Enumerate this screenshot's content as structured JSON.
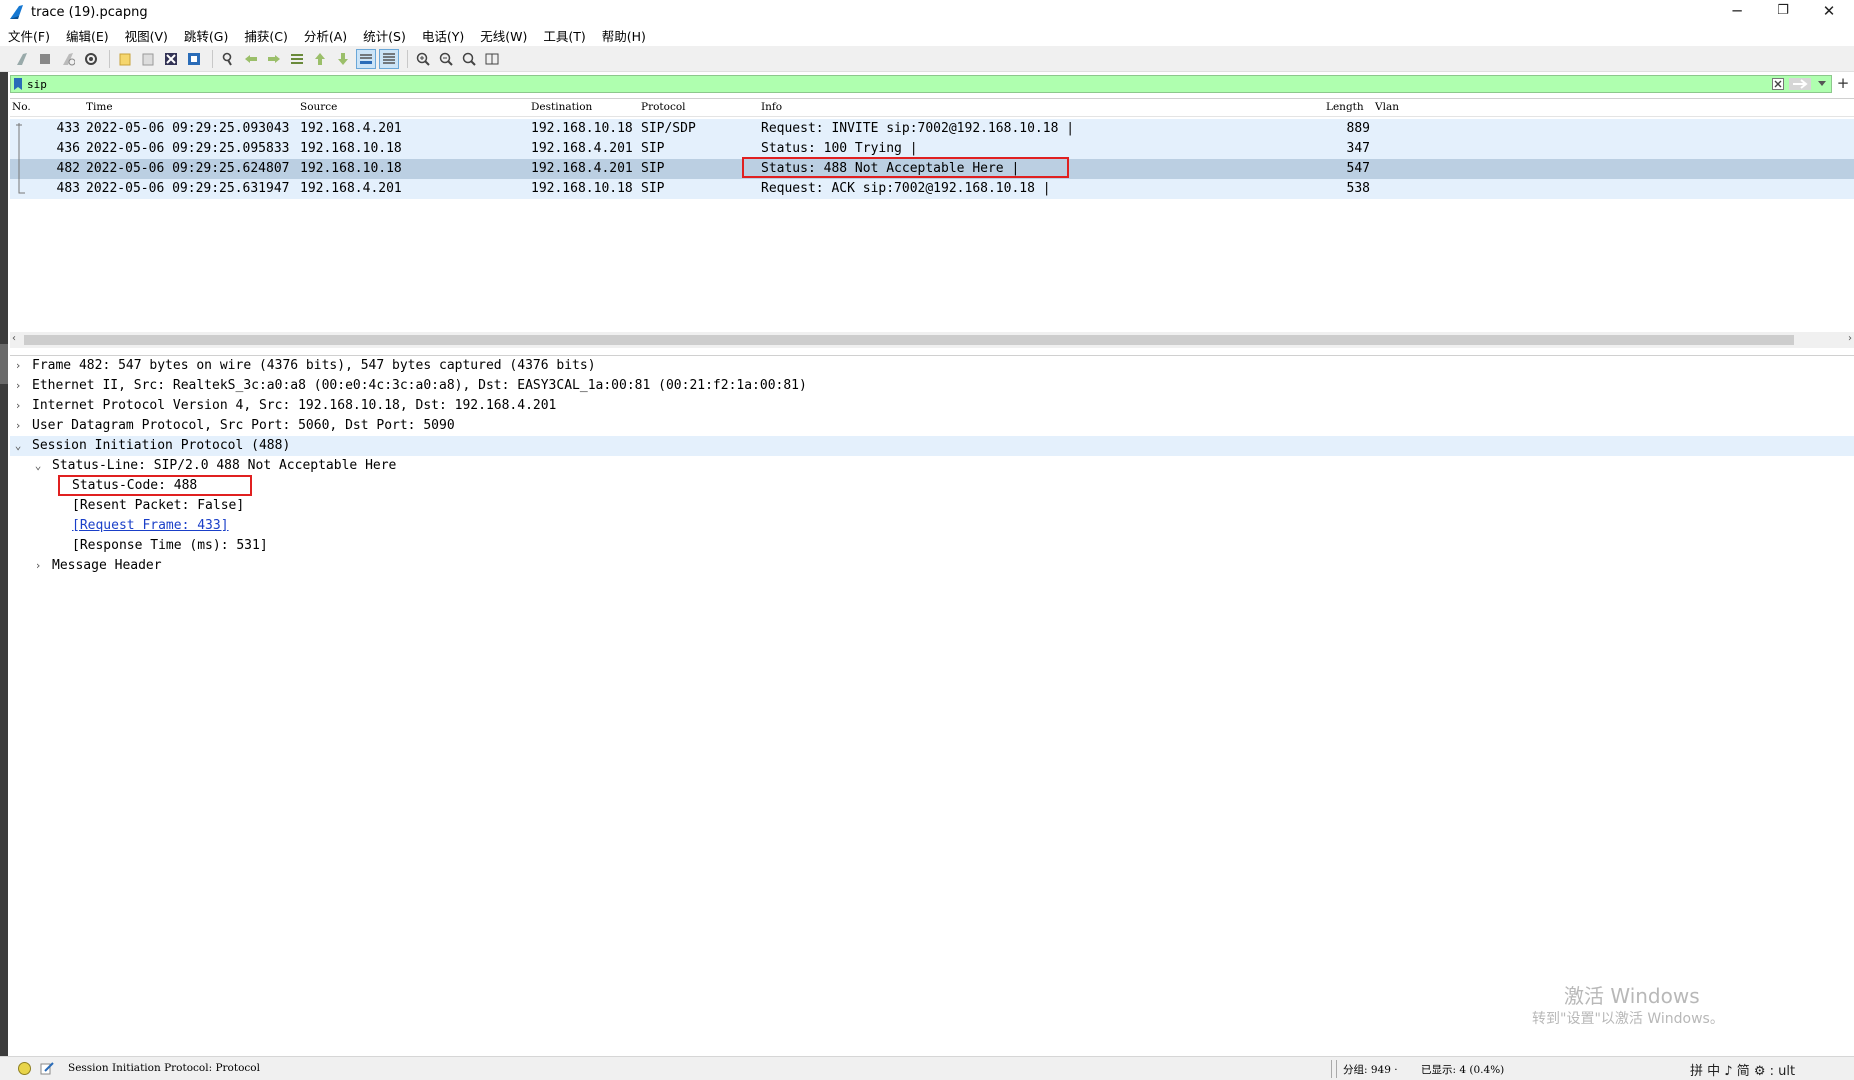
{
  "window": {
    "title": "trace (19).pcapng",
    "minimize": "─",
    "restore": "❐",
    "close": "✕"
  },
  "menu": [
    "文件(F)",
    "编辑(E)",
    "视图(V)",
    "跳转(G)",
    "捕获(C)",
    "分析(A)",
    "统计(S)",
    "电话(Y)",
    "无线(W)",
    "工具(T)",
    "帮助(H)"
  ],
  "filter": {
    "value": "sip"
  },
  "packet_list": {
    "columns": [
      "No.",
      "Time",
      "Source",
      "Destination",
      "Protocol",
      "Info",
      "Length",
      "Vlan"
    ],
    "rows": [
      {
        "no": "433",
        "time": "2022-05-06 09:29:25.093043",
        "source": "192.168.4.201",
        "destination": "192.168.10.18",
        "protocol": "SIP/SDP",
        "info": "Request: INVITE sip:7002@192.168.10.18 |",
        "length": "889"
      },
      {
        "no": "436",
        "time": "2022-05-06 09:29:25.095833",
        "source": "192.168.10.18",
        "destination": "192.168.4.201",
        "protocol": "SIP",
        "info": "Status: 100 Trying |",
        "length": "347"
      },
      {
        "no": "482",
        "time": "2022-05-06 09:29:25.624807",
        "source": "192.168.10.18",
        "destination": "192.168.4.201",
        "protocol": "SIP",
        "info": "Status: 488 Not Acceptable Here |",
        "length": "547"
      },
      {
        "no": "483",
        "time": "2022-05-06 09:29:25.631947",
        "source": "192.168.4.201",
        "destination": "192.168.10.18",
        "protocol": "SIP",
        "info": "Request: ACK sip:7002@192.168.10.18 |",
        "length": "538"
      }
    ],
    "selected_row": 2
  },
  "details": {
    "frame": "Frame 482: 547 bytes on wire (4376 bits), 547 bytes captured (4376 bits)",
    "ethernet": "Ethernet II, Src: RealtekS_3c:a0:a8 (00:e0:4c:3c:a0:a8), Dst: EASY3CAL_1a:00:81 (00:21:f2:1a:00:81)",
    "ip": "Internet Protocol Version 4, Src: 192.168.10.18, Dst: 192.168.4.201",
    "udp": "User Datagram Protocol, Src Port: 5060, Dst Port: 5090",
    "sip": "Session Initiation Protocol (488)",
    "status_line": "Status-Line: SIP/2.0 488 Not Acceptable Here",
    "status_code": "Status-Code: 488",
    "resent": "[Resent Packet: False]",
    "request_frame": "[Request Frame: 433]",
    "response_time": "[Response Time (ms): 531]",
    "message_header": "Message Header"
  },
  "watermark": {
    "title": "激活 Windows",
    "subtitle": "转到\"设置\"以激活 Windows。"
  },
  "statusbar": {
    "text": "Session Initiation Protocol: Protocol",
    "packets": "分组: 949 ·",
    "displayed": "已显示: 4 (0.4%)",
    "ime": "拼 中 ♪ 简 ⚙ : ult"
  }
}
